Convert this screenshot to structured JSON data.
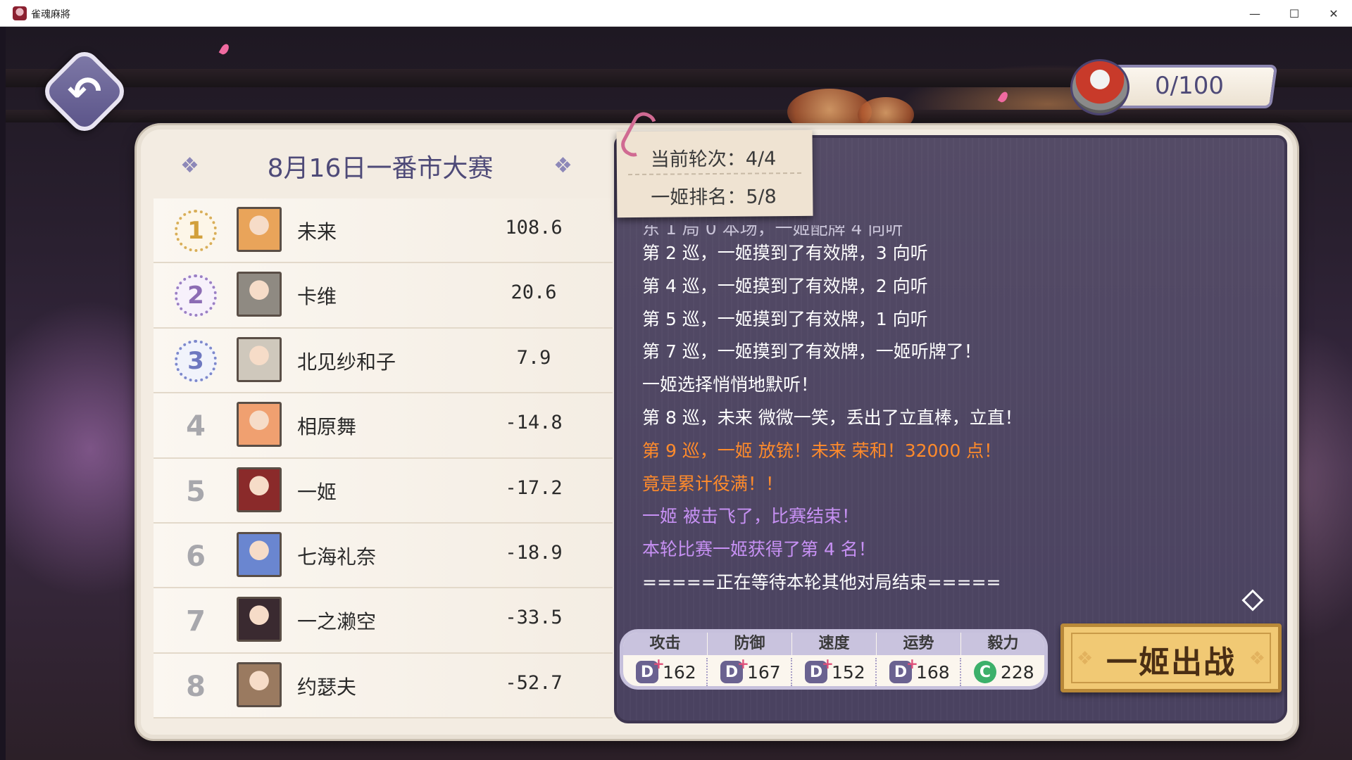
{
  "window": {
    "title": "雀魂麻將",
    "minimize": "—",
    "maximize": "☐",
    "close": "✕"
  },
  "back": {
    "icon": "back-arrow-icon",
    "glyph": "↶"
  },
  "token": {
    "value": "0/100",
    "icon": "cat-can-icon"
  },
  "tournament": {
    "title": "8月16日一番市大赛",
    "deco": "❖"
  },
  "rankings": [
    {
      "rank": "1",
      "name": "未来",
      "score": "108.6",
      "medal": "gold",
      "avatar_color": "#e9a45a"
    },
    {
      "rank": "2",
      "name": "卡维",
      "score": "20.6",
      "medal": "silver",
      "avatar_color": "#8f8a82"
    },
    {
      "rank": "3",
      "name": "北见纱和子",
      "score": "7.9",
      "medal": "bronze",
      "avatar_color": "#cfc8bc"
    },
    {
      "rank": "4",
      "name": "相原舞",
      "score": "-14.8",
      "medal": "",
      "avatar_color": "#f0a070"
    },
    {
      "rank": "5",
      "name": "一姬",
      "score": "-17.2",
      "medal": "",
      "avatar_color": "#8a2a2a"
    },
    {
      "rank": "6",
      "name": "七海礼奈",
      "score": "-18.9",
      "medal": "",
      "avatar_color": "#6a86d0"
    },
    {
      "rank": "7",
      "name": "一之濑空",
      "score": "-33.5",
      "medal": "",
      "avatar_color": "#3a2a30"
    },
    {
      "rank": "8",
      "name": "约瑟夫",
      "score": "-52.7",
      "medal": "",
      "avatar_color": "#9a7a60"
    }
  ],
  "note": {
    "round": "当前轮次：4/4",
    "standing": "一姬排名：5/8"
  },
  "log": [
    {
      "text": "东 1 局 0 本场，一姬配牌 4 向听",
      "style": "partial"
    },
    {
      "text": "第 2 巡，一姬摸到了有效牌，3 向听",
      "style": ""
    },
    {
      "text": "第 4 巡，一姬摸到了有效牌，2 向听",
      "style": ""
    },
    {
      "text": "第 5 巡，一姬摸到了有效牌，1 向听",
      "style": ""
    },
    {
      "text": "第 7 巡，一姬摸到了有效牌，一姬听牌了！",
      "style": ""
    },
    {
      "text": "一姬选择悄悄地默听！",
      "style": ""
    },
    {
      "text": "第 8 巡，未来 微微一笑，丢出了立直棒，立直！",
      "style": ""
    },
    {
      "text": "第 9 巡，一姬 放铳！未来 荣和！32000 点！",
      "style": "orange"
    },
    {
      "text": "竟是累计役满！！",
      "style": "orange"
    },
    {
      "text": "一姬 被击飞了，比赛结束！",
      "style": "purple"
    },
    {
      "text": "本轮比赛一姬获得了第 4 名！",
      "style": "purple"
    },
    {
      "text": "=====正在等待本轮其他对局结束=====",
      "style": ""
    }
  ],
  "stats": [
    {
      "label": "攻击",
      "grade": "D",
      "plus": "+",
      "value": "162"
    },
    {
      "label": "防御",
      "grade": "D",
      "plus": "+",
      "value": "167"
    },
    {
      "label": "速度",
      "grade": "D",
      "plus": "+",
      "value": "152"
    },
    {
      "label": "运势",
      "grade": "D",
      "plus": "+",
      "value": "168"
    },
    {
      "label": "毅力",
      "grade": "C",
      "plus": "",
      "value": "228"
    }
  ],
  "go_button": {
    "label": "一姬出战",
    "flare": "❖"
  },
  "colors": {
    "accent": "#4e4a78",
    "board": "#4a4260",
    "gold": "#f1c974",
    "orange": "#ff8a2a",
    "purple": "#c790f4"
  }
}
